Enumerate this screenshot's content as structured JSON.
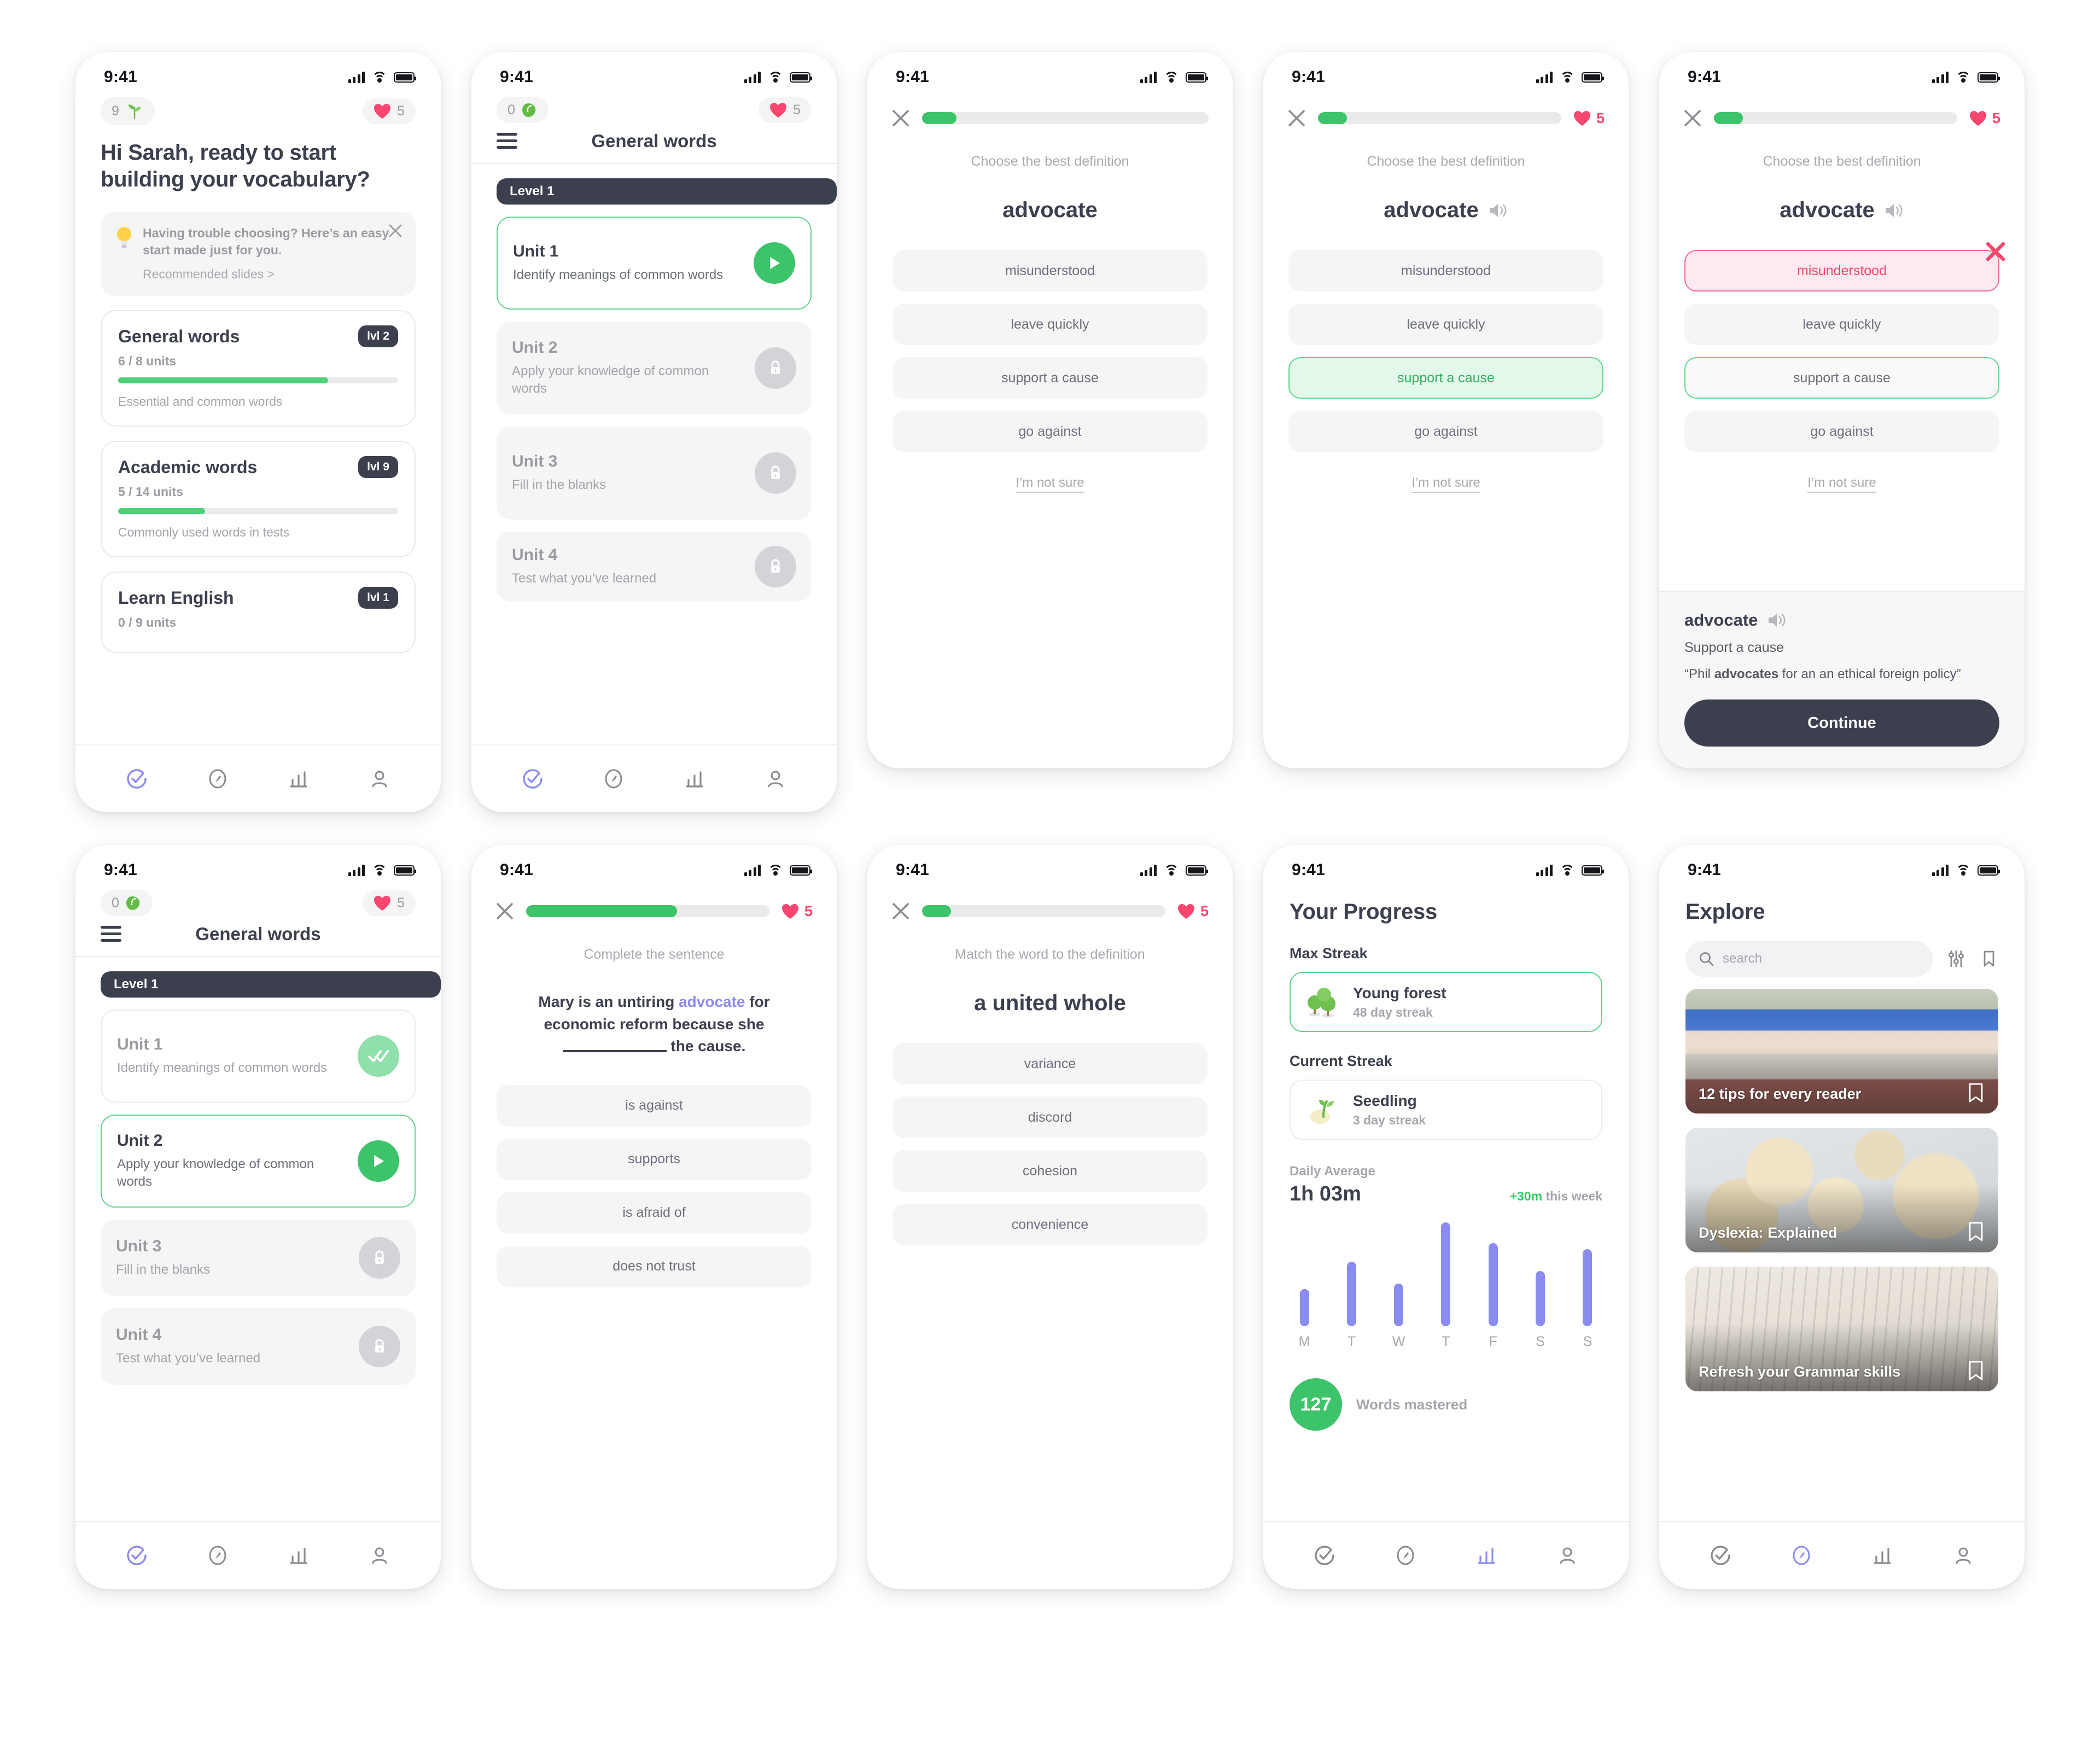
{
  "status_bar": {
    "time": "9:41"
  },
  "colors": {
    "green": "#3dc46a",
    "green_light": "#5fd48a",
    "pink": "#f8466f",
    "purple": "#8b8cf0",
    "dark": "#3c3f4d",
    "grey": "#f5f5f6"
  },
  "home": {
    "seed_count": "9",
    "seed_icon": "sprout-icon",
    "hearts": "5",
    "greeting": "Hi Sarah, ready to start building your vocabulary?",
    "tip": {
      "icon": "lightbulb-icon",
      "text": "Having trouble choosing? Here’s an easy start made just for you.",
      "link": "Recommended slides >",
      "close_icon": "close-icon"
    },
    "courses": [
      {
        "name": "General words",
        "level": "lvl 2",
        "units": "6 / 8 units",
        "progress": 75,
        "desc": "Essential and common words"
      },
      {
        "name": "Academic words",
        "level": "lvl 9",
        "units": "5 / 14 units",
        "progress": 31,
        "desc": "Commonly used words in tests"
      },
      {
        "name": "Learn English",
        "level": "lvl 1",
        "units": "0 / 9 units",
        "progress": 0,
        "desc": ""
      }
    ]
  },
  "units_locked": {
    "bean_count": "0",
    "bean_icon": "bean-icon",
    "hearts": "5",
    "title": "General words",
    "menu_icon": "hamburger-icon",
    "level_chip": "Level 1",
    "units": [
      {
        "name": "Unit 1",
        "desc": "Identify meanings of common words",
        "state": "active",
        "icon": "play-icon"
      },
      {
        "name": "Unit 2",
        "desc": "Apply your knowledge of common words",
        "state": "locked",
        "icon": "lock-icon"
      },
      {
        "name": "Unit 3",
        "desc": "Fill in the blanks",
        "state": "locked",
        "icon": "lock-icon"
      },
      {
        "name": "Unit 4",
        "desc": "Test what you’ve learned",
        "state": "locked",
        "icon": "lock-icon"
      }
    ]
  },
  "units_progressed": {
    "bean_count": "0",
    "bean_icon": "bean-icon",
    "hearts": "5",
    "title": "General words",
    "menu_icon": "hamburger-icon",
    "level_chip": "Level 1",
    "units": [
      {
        "name": "Unit 1",
        "desc": "Identify meanings of common words",
        "state": "done",
        "icon": "double-check-icon"
      },
      {
        "name": "Unit 2",
        "desc": "Apply your knowledge of common words",
        "state": "active",
        "icon": "play-icon"
      },
      {
        "name": "Unit 3",
        "desc": "Fill in the blanks",
        "state": "locked",
        "icon": "lock-icon"
      },
      {
        "name": "Unit 4",
        "desc": "Test what you’ve learned",
        "state": "locked",
        "icon": "lock-icon"
      }
    ]
  },
  "quiz_plain": {
    "progress": 12,
    "prompt": "Choose the best definition",
    "word": "advocate",
    "options": [
      "misunderstood",
      "leave quickly",
      "support a cause",
      "go against"
    ],
    "not_sure": "I’m not sure",
    "close_icon": "close-icon"
  },
  "quiz_correct": {
    "progress": 12,
    "hearts": "5",
    "prompt": "Choose the best definition",
    "word": "advocate",
    "speaker_icon": "speaker-icon",
    "options": [
      "misunderstood",
      "leave quickly",
      "support a cause",
      "go against"
    ],
    "correct_index": 2,
    "not_sure": "I’m not sure",
    "close_icon": "close-icon"
  },
  "quiz_wrong": {
    "progress": 12,
    "hearts": "5",
    "prompt": "Choose the best definition",
    "word": "advocate",
    "speaker_icon": "speaker-icon",
    "options": [
      "misunderstood",
      "leave quickly",
      "support a cause",
      "go against"
    ],
    "wrong_index": 0,
    "correct_index": 2,
    "wrong_badge_icon": "x-mark-icon",
    "not_sure": "I’m not sure",
    "close_icon": "close-icon",
    "definition": {
      "word": "advocate",
      "speaker_icon": "speaker-icon",
      "meaning": "Support a cause",
      "example_pre": "“Phil ",
      "example_bold": "advocates",
      "example_post": " for an an ethical foreign policy”",
      "continue_label": "Continue"
    }
  },
  "quiz_sentence": {
    "progress": 62,
    "hearts": "5",
    "prompt": "Complete the sentence",
    "sentence_pre": "Mary is an untiring ",
    "sentence_hl": "advocate",
    "sentence_mid": " for economic reform because she ",
    "sentence_post": " the cause.",
    "options": [
      "is against",
      "supports",
      "is afraid of",
      "does not trust"
    ],
    "close_icon": "close-icon"
  },
  "quiz_match": {
    "progress": 12,
    "hearts": "5",
    "prompt": "Match the word to the definition",
    "word": "a united whole",
    "options": [
      "variance",
      "discord",
      "cohesion",
      "convenience"
    ],
    "close_icon": "close-icon"
  },
  "progress_screen": {
    "title": "Your Progress",
    "max_streak_label": "Max Streak",
    "max_streak": {
      "icon": "trees-icon",
      "name": "Young forest",
      "sub": "48 day streak"
    },
    "current_streak_label": "Current Streak",
    "current_streak": {
      "icon": "seedling-icon",
      "name": "Seedling",
      "sub": "3 day streak"
    },
    "daily_average_label": "Daily Average",
    "daily_average_value": "1h 03m",
    "delta_value": "+30m",
    "delta_text": " this week",
    "mastered_count": "127",
    "mastered_label": "Words mastered"
  },
  "chart_data": {
    "type": "bar",
    "title": "Daily Average",
    "categories": [
      "M",
      "T",
      "W",
      "T",
      "F",
      "S",
      "S"
    ],
    "values": [
      36,
      62,
      41,
      100,
      80,
      53,
      74
    ],
    "xlabel": "",
    "ylabel": "",
    "ylim": [
      0,
      100
    ],
    "grid": false,
    "legend": "none",
    "annotation": "+30m this week",
    "series_color": "#8b8cf0"
  },
  "explore": {
    "title": "Explore",
    "search_placeholder": "search",
    "search_value": "",
    "search_icon": "search-icon",
    "filter_icon": "sliders-icon",
    "bookmark_icon": "bookmark-icon",
    "cards": [
      {
        "caption": "12 tips for every reader",
        "photo": "books-photo",
        "bookmark_icon": "bookmark-icon"
      },
      {
        "caption": "Dyslexia: Explained",
        "photo": "scrabble-photo",
        "bookmark_icon": "bookmark-icon"
      },
      {
        "caption": "Refresh your Grammar skills",
        "photo": "alphabet-photo",
        "bookmark_icon": "bookmark-icon"
      }
    ]
  },
  "tabbar": {
    "items": [
      {
        "name": "tab-learn",
        "icon": "check-circle-icon"
      },
      {
        "name": "tab-explore",
        "icon": "compass-icon"
      },
      {
        "name": "tab-progress",
        "icon": "bar-chart-icon"
      },
      {
        "name": "tab-profile",
        "icon": "person-icon"
      }
    ]
  }
}
